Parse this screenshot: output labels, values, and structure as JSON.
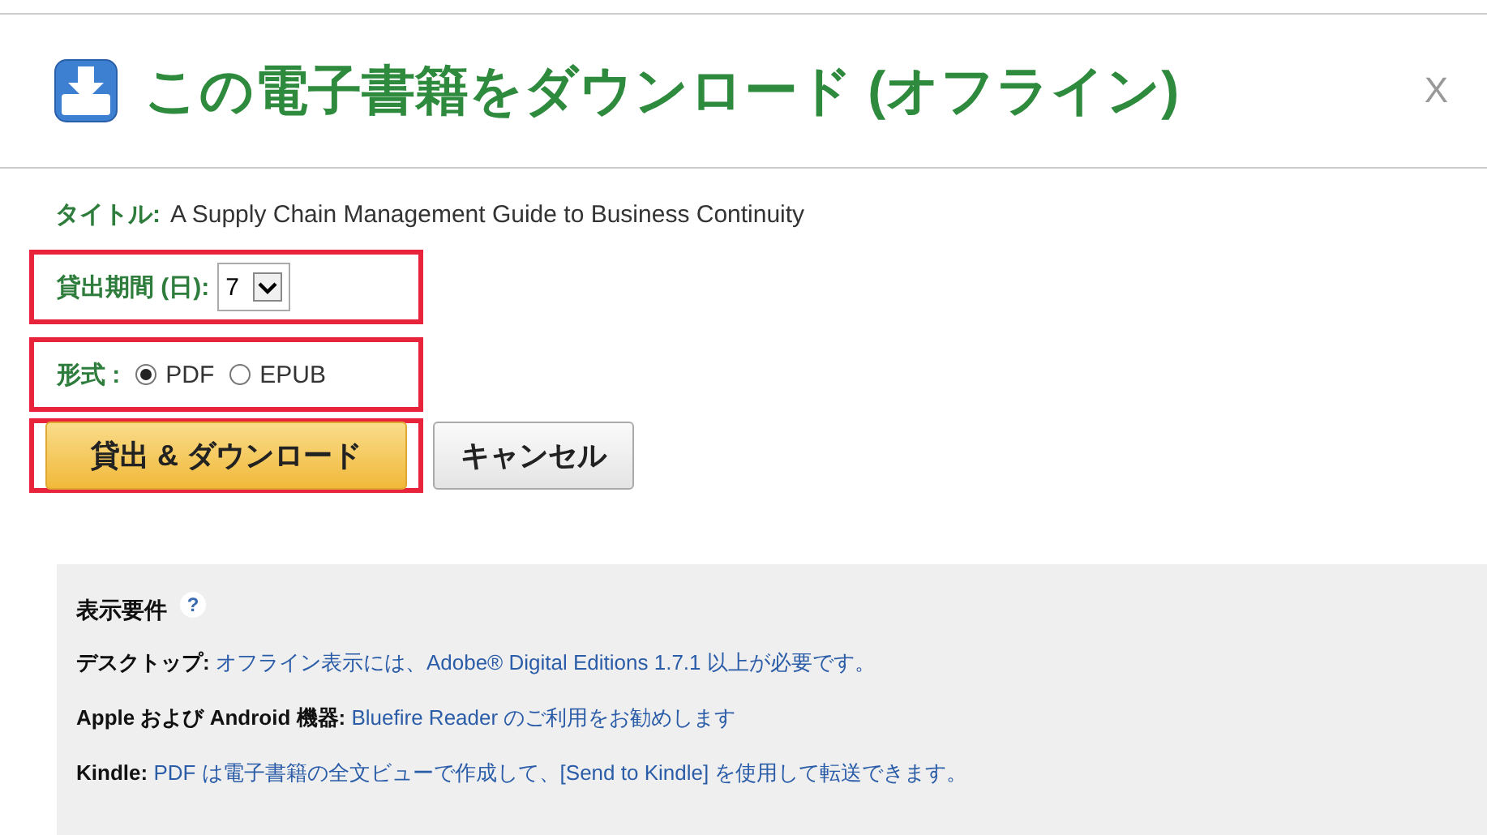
{
  "dialog": {
    "title": "この電子書籍をダウンロード (オフライン)",
    "close": "X"
  },
  "book_title": {
    "label": "タイトル:",
    "value": "A Supply Chain Management Guide to Business Continuity"
  },
  "loan_period": {
    "label": "貸出期間 (日):",
    "value": "7",
    "highlighted": true
  },
  "format": {
    "label": "形式 :",
    "highlighted": true,
    "options": [
      {
        "label": "PDF",
        "selected": true
      },
      {
        "label": "EPUB",
        "selected": false
      }
    ]
  },
  "buttons": [
    {
      "kind": "primary",
      "label": "貸出 & ダウンロード",
      "highlighted": true
    },
    {
      "kind": "secondary",
      "label": "キャンセル",
      "highlighted": false
    }
  ],
  "requirements": {
    "heading": "表示要件",
    "help": "?",
    "items": [
      {
        "label": "デスクトップ:",
        "text": "オフライン表示には、Adobe® Digital Editions 1.7.1 以上が必要です。"
      },
      {
        "label": "Apple および Android 機器:",
        "text": "Bluefire Reader のご利用をお勧めします"
      },
      {
        "label": "Kindle:",
        "text": "PDF は電子書籍の全文ビューで作成して、[Send to Kindle] を使用して転送できます。"
      }
    ]
  }
}
